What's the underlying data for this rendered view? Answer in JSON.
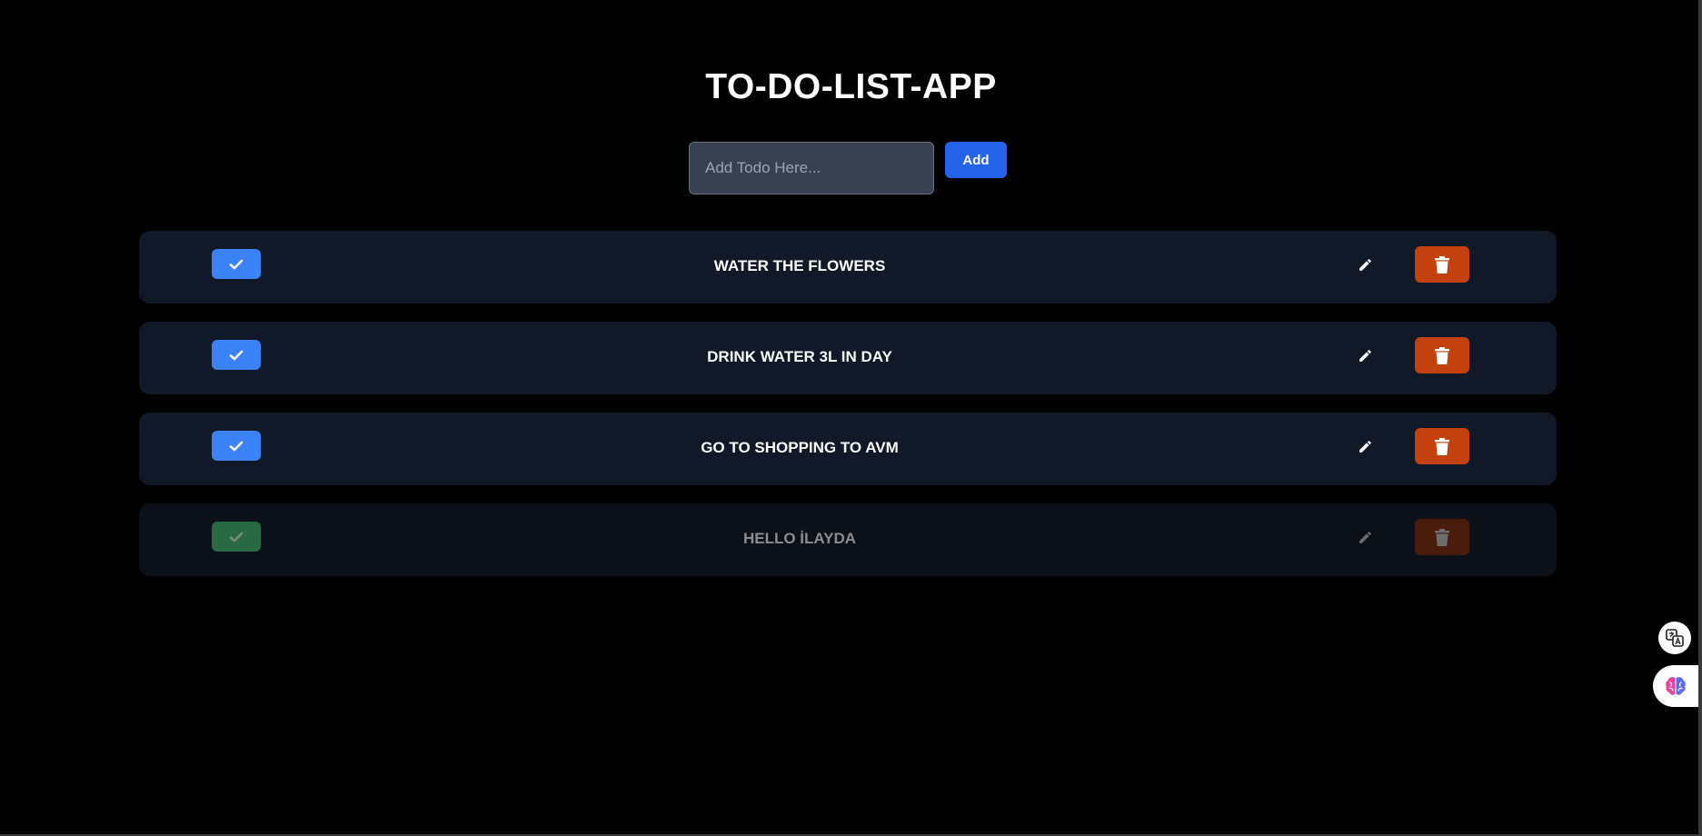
{
  "app": {
    "title": "TO-DO-LIST-APP"
  },
  "add_form": {
    "placeholder": "Add Todo Here...",
    "value": "",
    "button_label": "Add"
  },
  "todos": [
    {
      "text": "WATER THE FLOWERS",
      "completed": false
    },
    {
      "text": "DRINK WATER 3L IN DAY",
      "completed": false
    },
    {
      "text": "GO TO SHOPPING TO AVM",
      "completed": false
    },
    {
      "text": "HELLO İLAYDA",
      "completed": true
    }
  ],
  "icons": {
    "complete": "check-icon",
    "edit": "pencil-icon",
    "delete": "trash-icon",
    "translate_widget": "translate-icon",
    "ai_widget": "brain-icon"
  },
  "colors": {
    "background": "#000000",
    "card": "#111827",
    "card_done": "#0b1019",
    "check_button": "#3b82f6",
    "check_button_done": "#276a43",
    "delete_button": "#c2410c",
    "delete_button_done": "#4a1c0b",
    "add_button": "#2563eb",
    "input_background": "#374151"
  }
}
